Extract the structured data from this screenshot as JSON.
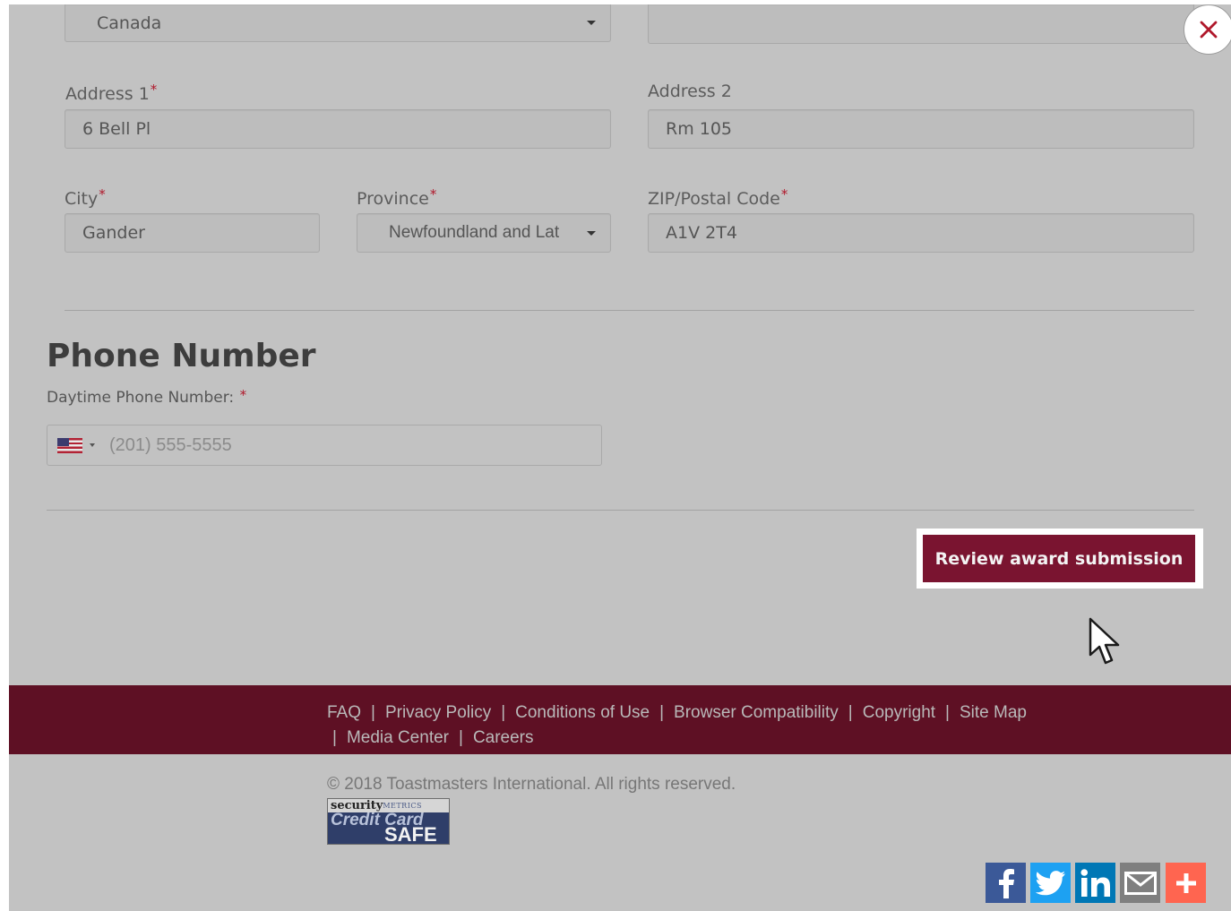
{
  "form": {
    "country_value": "Canada",
    "address1_label": "Address 1",
    "address1_value": "6 Bell Pl",
    "address2_label": "Address 2",
    "address2_value": "Rm 105",
    "city_label": "City",
    "city_value": "Gander",
    "province_label": "Province",
    "province_value": "Newfoundland and Lat",
    "postal_label": "ZIP/Postal Code",
    "postal_value": "A1V 2T4",
    "required_mark": "*"
  },
  "phone": {
    "heading": "Phone Number",
    "label": "Daytime Phone Number:",
    "required_mark": "*",
    "placeholder": "(201) 555-5555",
    "flag_icon": "us-flag-icon"
  },
  "actions": {
    "review_label": "Review award submission",
    "close_icon": "close-icon"
  },
  "footer": {
    "links": [
      "FAQ",
      "Privacy Policy",
      "Conditions of Use",
      "Browser Compatibility",
      "Copyright",
      "Site Map",
      "Media Center",
      "Careers"
    ],
    "separator": "|",
    "copyright": "© 2018 Toastmasters International.  All rights reserved.",
    "badge": {
      "security": "security",
      "metrics": "METRICS",
      "credit_card": "Credit Card",
      "safe": "SAFE"
    },
    "social": [
      "facebook-icon",
      "twitter-icon",
      "linkedin-icon",
      "email-icon",
      "share-plus-icon"
    ]
  },
  "colors": {
    "brand": "#7a1430",
    "footer_bg": "#5e1024",
    "required": "#b0182b",
    "facebook": "#3b5998",
    "twitter": "#1da1f2",
    "linkedin": "#0077b5",
    "email": "#7f7f7f",
    "share": "#ff6550"
  }
}
